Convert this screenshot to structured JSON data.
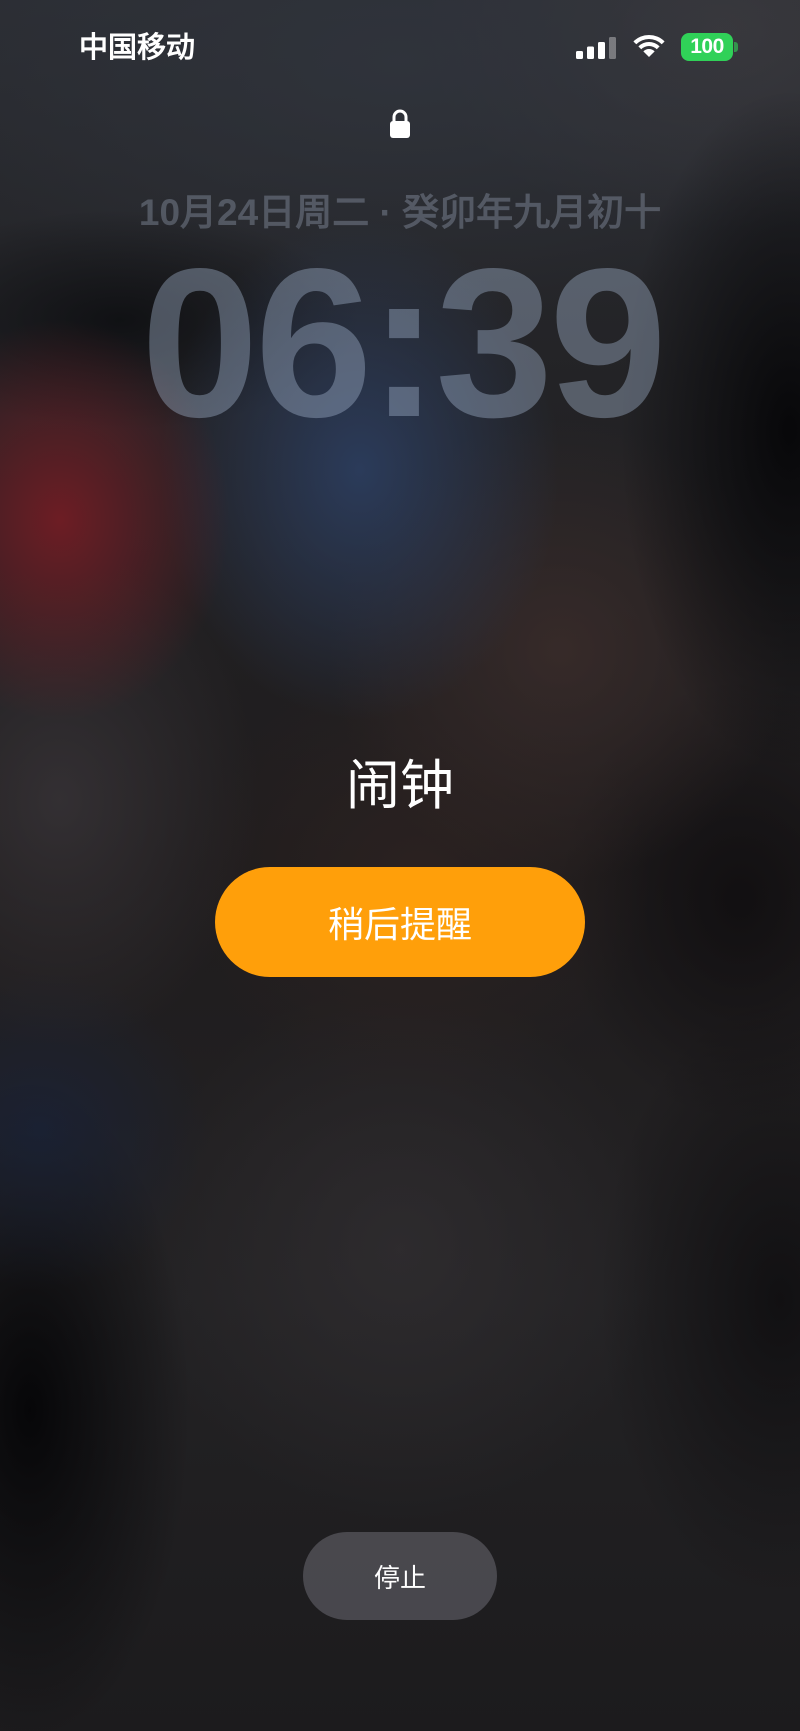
{
  "status_bar": {
    "carrier": "中国移动",
    "signal_strength": 3,
    "signal_max": 4,
    "battery_level": "100",
    "battery_color": "#30D158"
  },
  "icons": {
    "lock": "lock-icon",
    "signal": "cellular-signal-icon",
    "wifi": "wifi-icon",
    "battery": "battery-icon"
  },
  "lock_screen": {
    "date_line": "10月24日周二 · 癸卯年九月初十",
    "time": "06:39"
  },
  "alarm": {
    "title": "闹钟",
    "snooze_label": "稍后提醒",
    "stop_label": "停止",
    "snooze_color": "#FF9F0A"
  }
}
